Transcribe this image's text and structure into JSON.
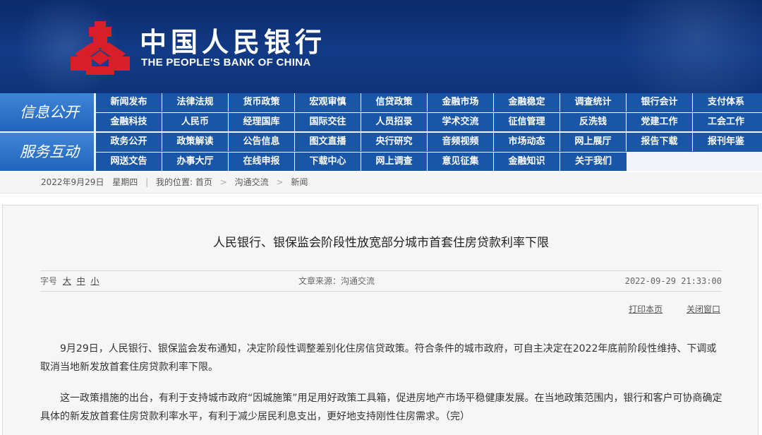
{
  "header": {
    "logo_cn": "中国人民银行",
    "logo_en": "THE PEOPLE'S BANK OF CHINA",
    "brand_color": "#c8102e"
  },
  "nav": {
    "groups": [
      {
        "label": "信息公开",
        "rows": [
          [
            "新闻发布",
            "法律法规",
            "货币政策",
            "宏观审慎",
            "信贷政策",
            "金融市场",
            "金融稳定",
            "调查统计",
            "银行会计",
            "支付体系"
          ],
          [
            "金融科技",
            "人民币",
            "经理国库",
            "国际交往",
            "人员招录",
            "学术交流",
            "征信管理",
            "反洗钱",
            "党建工作",
            "工会工作"
          ]
        ]
      },
      {
        "label": "服务互动",
        "rows": [
          [
            "政务公开",
            "政策解读",
            "公告信息",
            "图文直播",
            "央行研究",
            "音频视频",
            "市场动态",
            "网上展厅",
            "报告下载",
            "报刊年鉴"
          ],
          [
            "网送文告",
            "办事大厅",
            "在线申报",
            "下载中心",
            "网上调查",
            "意见征集",
            "金融知识",
            "关于我们"
          ]
        ]
      }
    ]
  },
  "breadcrumb": {
    "date": "2022年9月29日",
    "weekday": "星期四",
    "location_label": "我的位置:",
    "items": [
      "首页",
      "沟通交流",
      "新闻"
    ]
  },
  "article": {
    "title": "人民银行、银保监会阶段性放宽部分城市首套住房贷款利率下限",
    "font_size_label": "字号",
    "font_sizes": [
      "大",
      "中",
      "小"
    ],
    "source": "文章来源：沟通交流",
    "datetime": "2022-09-29 21:33:00",
    "print_label": "打印本页",
    "close_label": "关闭窗口",
    "paragraphs": [
      "9月29日，人民银行、银保监会发布通知，决定阶段性调整差别化住房信贷政策。符合条件的城市政府，可自主决定在2022年底前阶段性维持、下调或取消当地新发放首套住房贷款利率下限。",
      "这一政策措施的出台，有利于支持城市政府“因城施策”用足用好政策工具箱，促进房地产市场平稳健康发展。在当地政策范围内，银行和客户可协商确定具体的新发放首套住房贷款利率水平，有利于减少居民利息支出，更好地支持刚性住房需求。（完）"
    ]
  }
}
